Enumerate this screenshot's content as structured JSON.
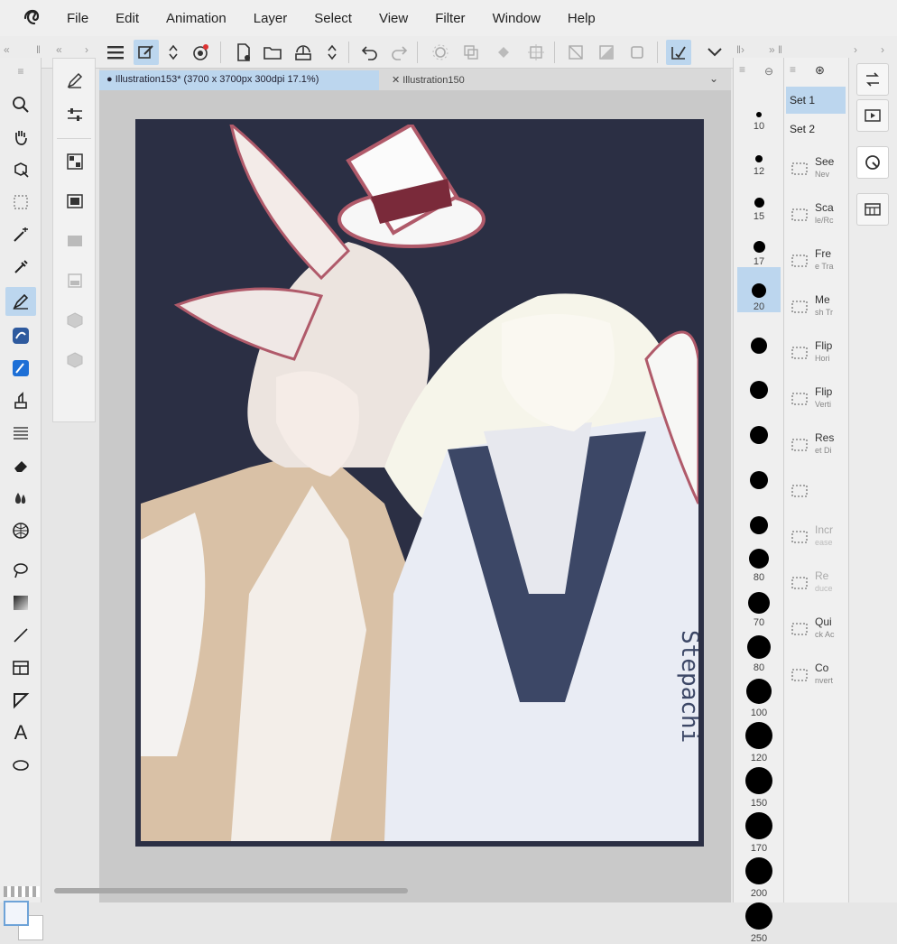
{
  "menu": [
    "File",
    "Edit",
    "Animation",
    "Layer",
    "Select",
    "View",
    "Filter",
    "Window",
    "Help"
  ],
  "tabs": [
    {
      "label": "Illustration153* (3700 x 3700px 300dpi 17.1%)",
      "active": true
    },
    {
      "label": "Illustration150",
      "active": false
    }
  ],
  "brush_sizes": [
    "10",
    "12",
    "15",
    "17",
    "20",
    "",
    "",
    "",
    "",
    "",
    "80",
    "70",
    "80",
    "100",
    "120",
    "150",
    "170",
    "200",
    "250"
  ],
  "brush_sizes_active_index": 4,
  "sets": [
    "Set 1",
    "Set 2"
  ],
  "actions": [
    {
      "title": "See",
      "sub": "Nev",
      "icon": "new-icon"
    },
    {
      "title": "Sca",
      "sub": "le/Rc",
      "icon": "scale-icon"
    },
    {
      "title": "Fre",
      "sub": "e Tra",
      "icon": "free-transform-icon"
    },
    {
      "title": "Me",
      "sub": "sh Tr",
      "icon": "mesh-icon"
    },
    {
      "title": "Flip",
      "sub": "Hori",
      "icon": "flip-h-icon"
    },
    {
      "title": "Flip",
      "sub": "Verti",
      "icon": "flip-v-icon"
    },
    {
      "title": "Res",
      "sub": "et Di",
      "icon": "reset-icon"
    },
    {
      "title": "",
      "sub": "",
      "icon": "blank-icon"
    },
    {
      "title": "Incr",
      "sub": "ease",
      "icon": "increase-icon"
    },
    {
      "title": "Re",
      "sub": "duce",
      "icon": "reduce-icon"
    },
    {
      "title": "Qui",
      "sub": "ck Ac",
      "icon": "wrench-icon"
    },
    {
      "title": "Co",
      "sub": "nvert",
      "icon": "convert-icon"
    }
  ],
  "signature": "Stepachi",
  "colors": {
    "accent": "#bcd6ee",
    "canvas_bg": "#2b2f44"
  }
}
